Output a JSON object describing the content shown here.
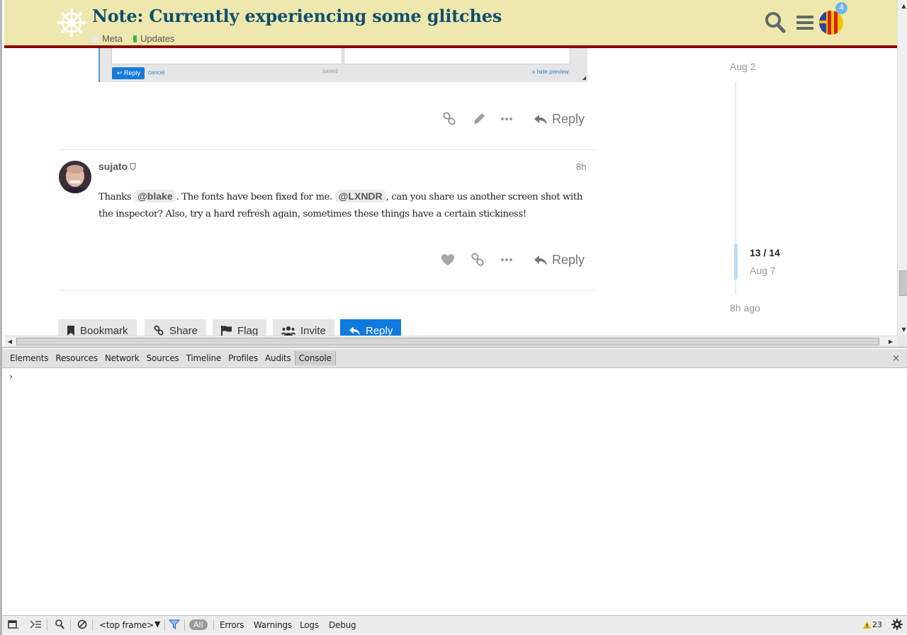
{
  "header": {
    "title": "Note: Currently experiencing some glitches",
    "categories": [
      {
        "label": "Meta",
        "color": "#e8e8e8"
      },
      {
        "label": "Updates",
        "color": "#3ab54a"
      }
    ],
    "notification_count": "4",
    "icons": {
      "logo": "dharma-wheel-icon",
      "search": "search-icon",
      "menu": "hamburger-menu-icon"
    }
  },
  "prev_post": {
    "embedded_screenshot": {
      "reply_label": "Reply",
      "cancel_label": "cancel",
      "saved_label": "saved",
      "hide_preview_label": "« hide preview"
    },
    "reply_label": "Reply"
  },
  "post": {
    "username": "sujato",
    "time": "8h",
    "body": {
      "t1": "Thanks ",
      "mention1": "@blake",
      "t2": ". The fonts have been fixed for me. ",
      "mention2": "@LXNDR",
      "t3": ", can you share us another screen shot with the inspector? Also, try a hard refresh again, sometimes these things have a certain stickiness!"
    },
    "reply_label": "Reply"
  },
  "timeline": {
    "top_date": "Aug 2",
    "progress": "13 / 14",
    "current_date": "Aug 7",
    "bottom_ago": "8h ago",
    "position_fraction": 0.93
  },
  "topic_buttons": {
    "bookmark": "Bookmark",
    "share": "Share",
    "flag": "Flag",
    "invite": "Invite",
    "reply": "Reply"
  },
  "devtools": {
    "tabs": [
      "Elements",
      "Resources",
      "Network",
      "Sources",
      "Timeline",
      "Profiles",
      "Audits",
      "Console"
    ],
    "active_tab": "Console",
    "close": "×",
    "prompt": "›",
    "status": {
      "frame": "<top frame>",
      "all": "All",
      "errors": "Errors",
      "warnings": "Warnings",
      "logs": "Logs",
      "debug": "Debug",
      "warning_count": "23"
    }
  },
  "colors": {
    "header_bg": "#efe8ae",
    "header_border": "#8b0a0a",
    "title": "#0e4f6e",
    "primary_button": "#0e7ae0",
    "badge": "#6fb6ea"
  }
}
